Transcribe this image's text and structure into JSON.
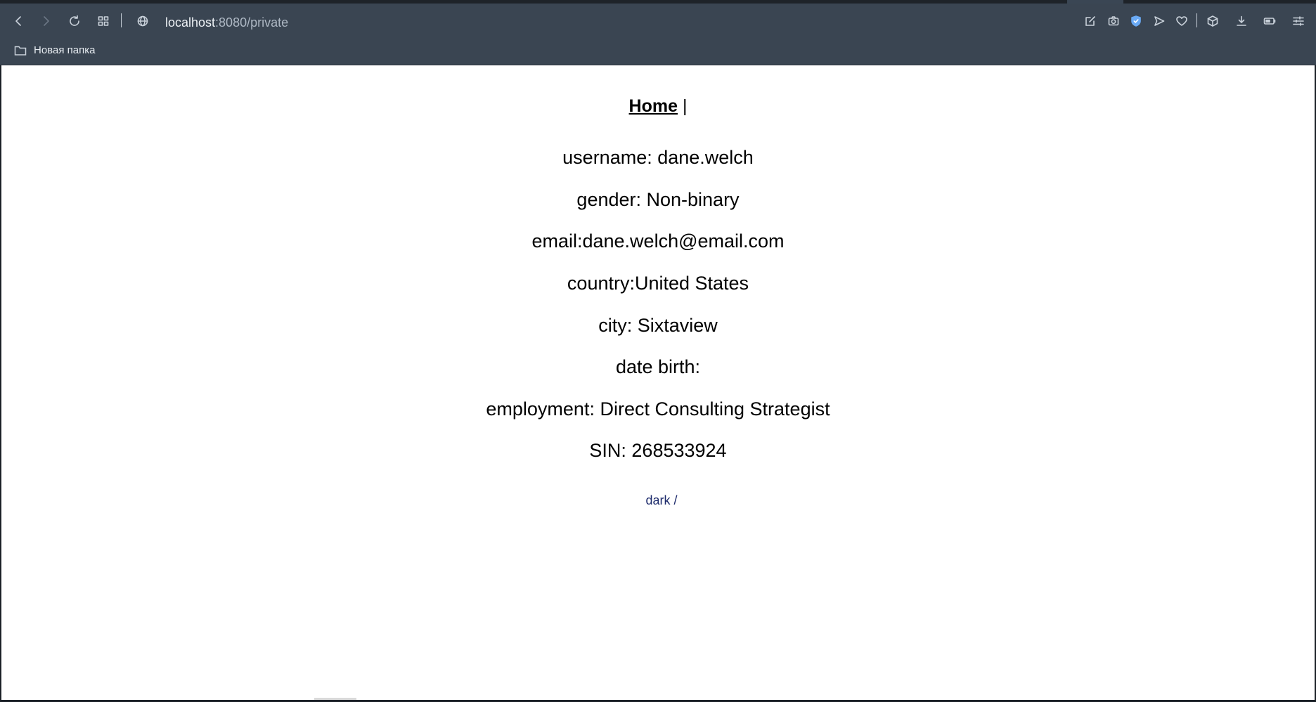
{
  "browser": {
    "url_host": "localhost",
    "url_path": ":8080/private",
    "bookmarks": [
      {
        "label": "Новая папка",
        "icon": "folder-icon"
      }
    ]
  },
  "page": {
    "nav": {
      "home_label": "Home",
      "separator": "|"
    },
    "fields": [
      {
        "text": "username: dane.welch"
      },
      {
        "text": "gender: Non-binary"
      },
      {
        "text": "email:dane.welch@email.com"
      },
      {
        "text": "country:United States"
      },
      {
        "text": "city: Sixtaview"
      },
      {
        "text": "date birth:"
      },
      {
        "text": "employment: Direct Consulting Strategist"
      },
      {
        "text": "SIN: 268533924"
      }
    ],
    "theme": {
      "dark_label": "dark",
      "separator": "/"
    }
  },
  "colors": {
    "toolbar_bg": "#3a4552",
    "page_bg": "#ffffff",
    "link_text": "#1c2a6b",
    "shield_accent": "#6aaaf5"
  }
}
